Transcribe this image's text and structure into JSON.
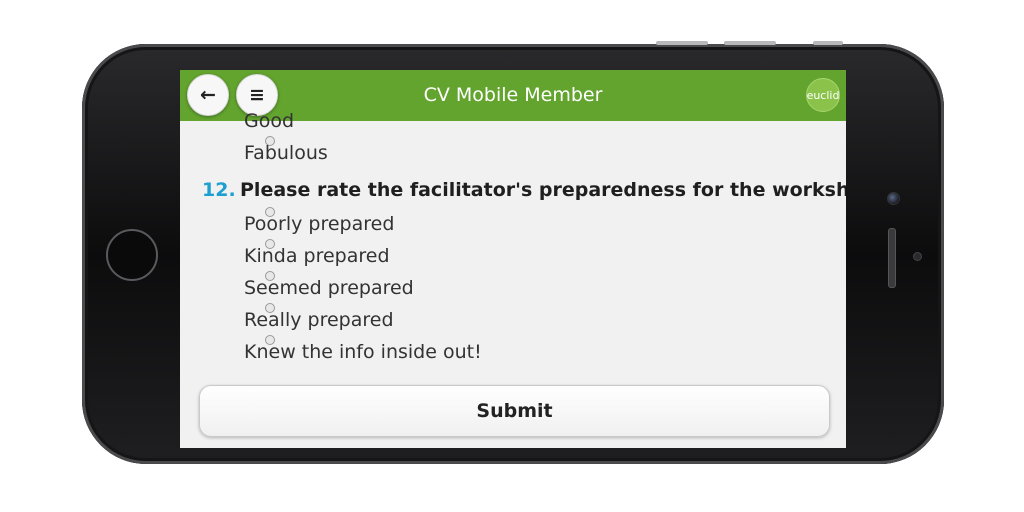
{
  "header": {
    "title": "CV Mobile Member",
    "back_icon": "←",
    "menu_icon": "≡",
    "logo_text": "euclid"
  },
  "survey": {
    "previous_options": [
      "Good",
      "Fabulous"
    ],
    "question": {
      "number": "12.",
      "text": "Please rate the facilitator's preparedness for the workshop:",
      "options": [
        "Poorly prepared",
        "Kinda prepared",
        "Seemed prepared",
        "Really prepared",
        "Knew the info inside out!"
      ]
    },
    "submit_label": "Submit"
  },
  "colors": {
    "header_bg": "#63a42f",
    "question_number": "#1e9fd1"
  }
}
